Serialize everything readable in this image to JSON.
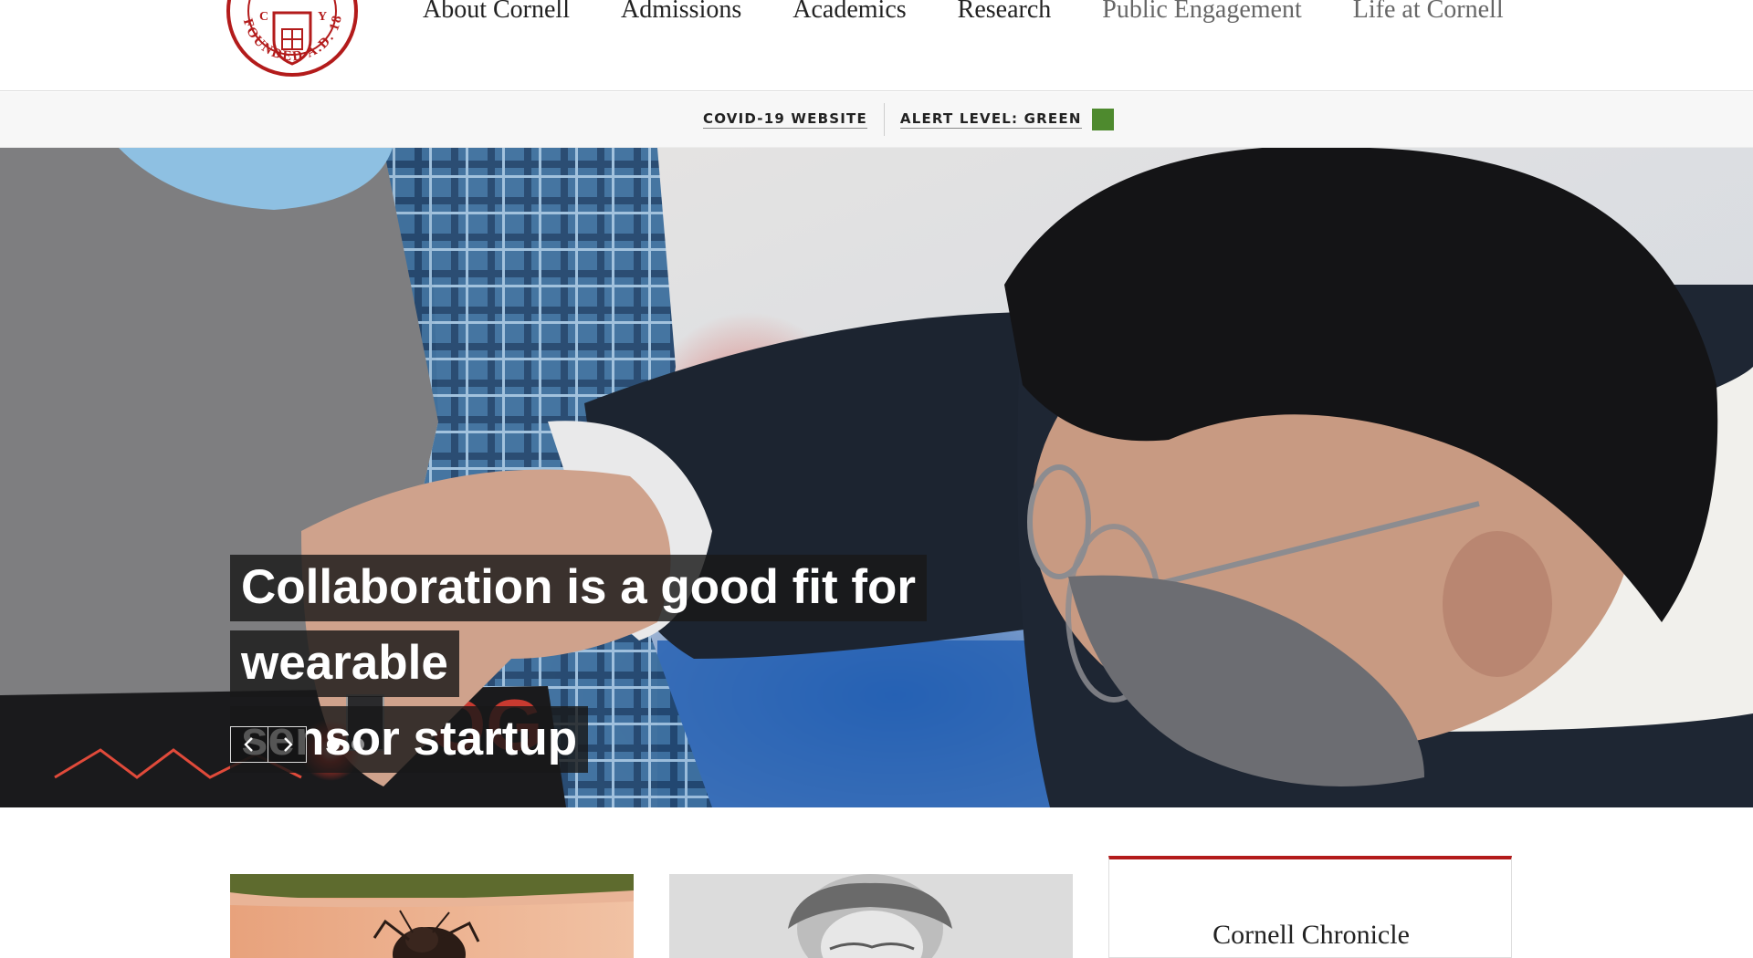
{
  "header": {
    "seal_name": "cornell-seal",
    "nav": [
      {
        "label": "About Cornell"
      },
      {
        "label": "Admissions"
      },
      {
        "label": "Academics"
      },
      {
        "label": "Research"
      },
      {
        "label": "Public Engagement"
      },
      {
        "label": "Life at Cornell"
      }
    ]
  },
  "alert_bar": {
    "covid_link": "COVID-19 WEBSITE",
    "alert_level": "ALERT LEVEL: GREEN",
    "alert_color": "#4e8a2e"
  },
  "hero": {
    "headline_line1": "Collaboration is a good fit for wearable",
    "headline_line2": "sensor startup",
    "prev_icon": "chevron-left-icon",
    "next_icon": "chevron-right-icon",
    "slides_count": 2,
    "active_slide": 1
  },
  "cards": {
    "chronicle_title": "Cornell Chronicle"
  },
  "colors": {
    "brand_red": "#b31b1b",
    "alert_green": "#4e8a2e",
    "text": "#222222"
  }
}
